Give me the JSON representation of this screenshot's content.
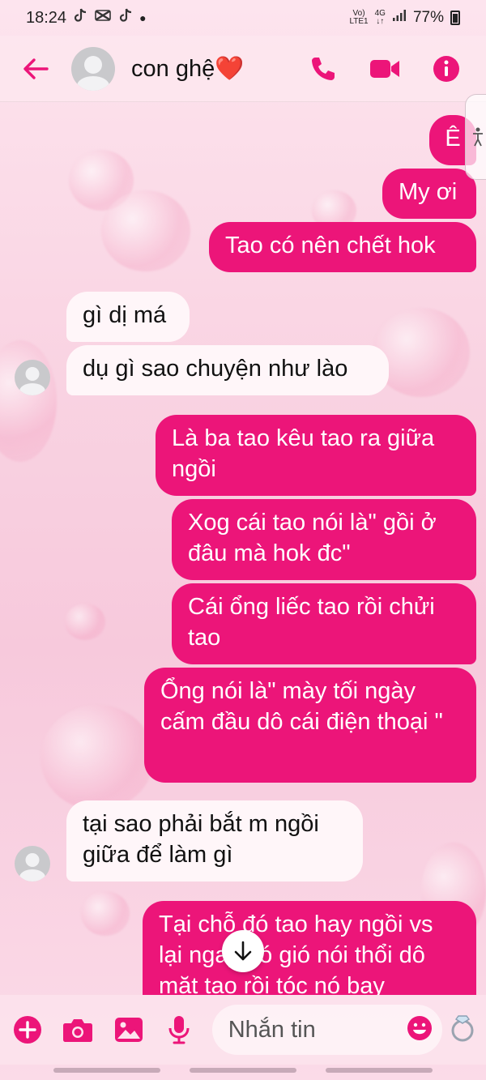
{
  "status_bar": {
    "time": "18:24",
    "network_left": "Vo)",
    "network_left2": "LTE1",
    "network_gen": "4G",
    "battery": "77%",
    "notification_icons": [
      "tiktok-icon",
      "capcut-icon",
      "tiktok-icon"
    ]
  },
  "header": {
    "contact_name": "con ghệ❤️",
    "icons": [
      "back-arrow-icon",
      "phone-icon",
      "video-camera-icon",
      "info-icon"
    ],
    "accent_color": "#ec1579"
  },
  "messages": [
    {
      "direction": "out",
      "text": "Ê"
    },
    {
      "direction": "out",
      "text": "My ơi"
    },
    {
      "direction": "out",
      "text": "Tao có nên chết hok"
    },
    {
      "direction": "in",
      "text": "gì dị má"
    },
    {
      "direction": "in",
      "text": "dụ gì sao chuyện như lào"
    },
    {
      "direction": "out",
      "text": "Là ba tao kêu tao ra giữa ngồi"
    },
    {
      "direction": "out",
      "text": "Xog cái tao nói là\" gồi ở đâu mà hok đc\""
    },
    {
      "direction": "out",
      "text": "Cái ổng liếc tao rồi chửi tao"
    },
    {
      "direction": "out",
      "text": "Ổng nói là\" mày tối ngày cấm đầu dô cái điện thoại \""
    },
    {
      "direction": "in",
      "text": "tại sao phải bắt m ngồi giữa để làm gì"
    },
    {
      "direction": "out",
      "text": "Tại chỗ đó tao hay ngồi vs lại ngay đó gió nói thổi dô mặt tao rồi tóc nó bay"
    }
  ],
  "composer": {
    "placeholder": "Nhắn tin",
    "icons": [
      "plus-icon",
      "camera-icon",
      "image-icon",
      "microphone-icon",
      "emoji-icon",
      "ring-icon"
    ]
  },
  "colors": {
    "outgoing_bubble": "#ec1579",
    "incoming_bubble": "#fff6f9",
    "background": "#f9d3e2"
  }
}
